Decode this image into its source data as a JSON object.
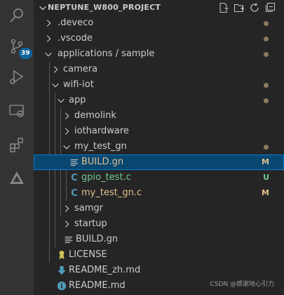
{
  "colors": {
    "activity_bar": "#333333",
    "sidebar": "#252526",
    "selection": "#094771",
    "focus_border": "#007fd4",
    "modified": "#e2c08d",
    "untracked": "#73c991",
    "c_icon": "#519aba",
    "badge": "#0e639c"
  },
  "activity": {
    "items": [
      {
        "name": "search-icon"
      },
      {
        "name": "source-control-icon",
        "badge": "39"
      },
      {
        "name": "run-debug-icon"
      },
      {
        "name": "remote-explorer-icon"
      },
      {
        "name": "extensions-icon"
      },
      {
        "name": "deveco-icon"
      }
    ]
  },
  "explorer": {
    "title": "NEPTUNE_W800_PROJECT",
    "actions": [
      "new-file-icon",
      "new-folder-icon",
      "refresh-icon",
      "collapse-all-icon"
    ],
    "tree": [
      {
        "label": ".deveco",
        "type": "folder",
        "expanded": false,
        "decoration": "dot"
      },
      {
        "label": ".vscode",
        "type": "folder",
        "expanded": false,
        "decoration": "dot"
      },
      {
        "label": "applications / sample",
        "type": "folder",
        "expanded": true,
        "decoration": "dot"
      },
      {
        "label": "camera",
        "type": "folder",
        "expanded": false
      },
      {
        "label": "wifi-iot",
        "type": "folder",
        "expanded": true,
        "decoration": "dot"
      },
      {
        "label": "app",
        "type": "folder",
        "expanded": true,
        "decoration": "dot"
      },
      {
        "label": "demolink",
        "type": "folder",
        "expanded": false
      },
      {
        "label": "iothardware",
        "type": "folder",
        "expanded": false
      },
      {
        "label": "my_test_gn",
        "type": "folder",
        "expanded": true,
        "decoration": "dot"
      },
      {
        "label": "BUILD.gn",
        "type": "file",
        "icon": "lines-icon",
        "status": "M",
        "selected": true
      },
      {
        "label": "gpio_test.c",
        "type": "file",
        "icon": "c-file-icon",
        "status": "U"
      },
      {
        "label": "my_test_gn.c",
        "type": "file",
        "icon": "c-file-icon",
        "status": "M"
      },
      {
        "label": "samgr",
        "type": "folder",
        "expanded": false
      },
      {
        "label": "startup",
        "type": "folder",
        "expanded": false
      },
      {
        "label": "BUILD.gn",
        "type": "file",
        "icon": "lines-icon"
      },
      {
        "label": "LICENSE",
        "type": "file",
        "icon": "license-icon"
      },
      {
        "label": "README_zh.md",
        "type": "file",
        "icon": "download-arrow-icon"
      },
      {
        "label": "README.md",
        "type": "file",
        "icon": "info-icon"
      }
    ]
  },
  "watermark": "CSDN @感谢地心引力"
}
